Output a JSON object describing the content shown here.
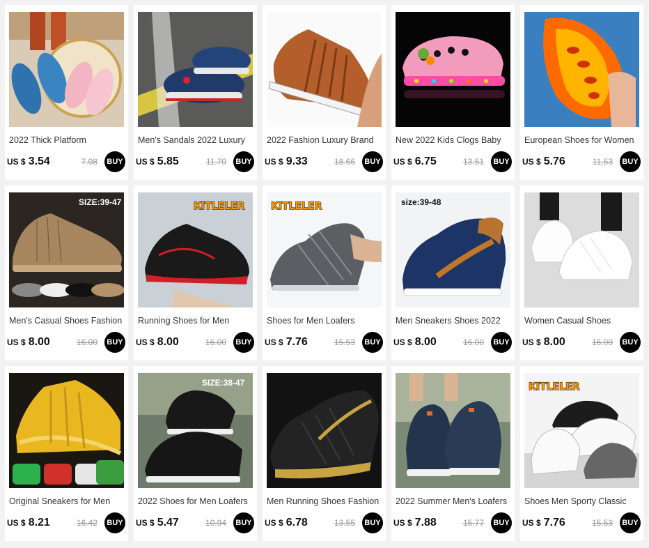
{
  "currency": "US $",
  "buy_label": "BUY",
  "products": [
    {
      "title": "2022 Thick Platform",
      "price": "3.54",
      "old_price": "7.08",
      "image": "blue-and-pink-slides",
      "badge": ""
    },
    {
      "title": "Men's Sandals 2022 Luxury",
      "price": "5.85",
      "old_price": "11.70",
      "image": "navy-clogs",
      "badge": ""
    },
    {
      "title": "2022 Fashion Luxury Brand",
      "price": "9.33",
      "old_price": "18.66",
      "image": "woven-leather-sandal",
      "badge": ""
    },
    {
      "title": "New 2022 Kids Clogs Baby",
      "price": "6.75",
      "old_price": "13.51",
      "image": "pink-led-clogs",
      "badge": ""
    },
    {
      "title": "European Shoes for Women",
      "price": "5.76",
      "old_price": "11.53",
      "image": "orange-foam-runners",
      "badge": ""
    },
    {
      "title": "Men's Casual Shoes Fashion",
      "price": "8.00",
      "old_price": "16.00",
      "image": "khaki-knit-sneakers",
      "badge": "SIZE:39-47"
    },
    {
      "title": "Running Shoes for Men",
      "price": "8.00",
      "old_price": "16.00",
      "image": "black-red-running-shoe",
      "badge": "KITLELER"
    },
    {
      "title": "Shoes for Men Loafers",
      "price": "7.76",
      "old_price": "15.53",
      "image": "grey-knit-slipon",
      "badge": "KITLELER"
    },
    {
      "title": "Men Sneakers Shoes 2022",
      "price": "8.00",
      "old_price": "16.00",
      "image": "navy-leather-sneaker",
      "badge": "size:39-48"
    },
    {
      "title": "Women Casual Shoes",
      "price": "8.00",
      "old_price": "16.00",
      "image": "white-women-sneakers",
      "badge": ""
    },
    {
      "title": "Original Sneakers for Men",
      "price": "8.21",
      "old_price": "16.42",
      "image": "yellow-blade-sneakers",
      "badge": ""
    },
    {
      "title": "2022 Shoes for Men Loafers",
      "price": "5.47",
      "old_price": "10.94",
      "image": "black-mvp-slipons",
      "badge": "SIZE:38-47"
    },
    {
      "title": "Men Running Shoes Fashion",
      "price": "6.78",
      "old_price": "13.55",
      "image": "black-gold-running-shoe",
      "badge": ""
    },
    {
      "title": "2022 Summer Men's Loafers",
      "price": "7.88",
      "old_price": "15.77",
      "image": "dark-mesh-loafers",
      "badge": ""
    },
    {
      "title": "Shoes Men Sporty Classic",
      "price": "7.76",
      "old_price": "15.53",
      "image": "white-black-grey-sneakers",
      "badge": "KITLELER"
    }
  ]
}
